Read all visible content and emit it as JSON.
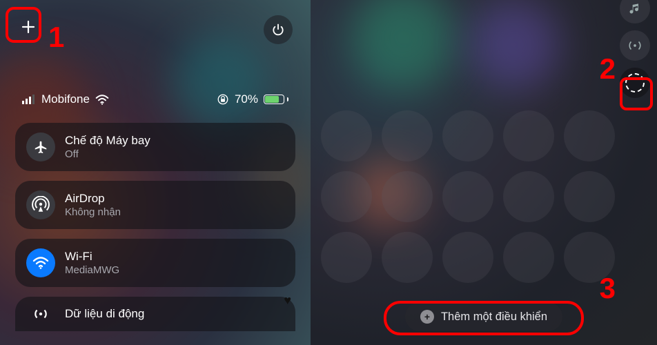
{
  "annotations": {
    "n1": "1",
    "n2": "2",
    "n3": "3"
  },
  "left": {
    "status": {
      "carrier": "Mobifone",
      "battery_pct": "70%"
    },
    "cards": {
      "airplane": {
        "title": "Chế độ Máy bay",
        "sub": "Off"
      },
      "airdrop": {
        "title": "AirDrop",
        "sub": "Không nhận"
      },
      "wifi": {
        "title": "Wi-Fi",
        "sub": "MediaMWG"
      },
      "cellular": {
        "title": "Dữ liệu di động"
      }
    }
  },
  "right": {
    "add_control_label": "Thêm một điều khiển"
  }
}
